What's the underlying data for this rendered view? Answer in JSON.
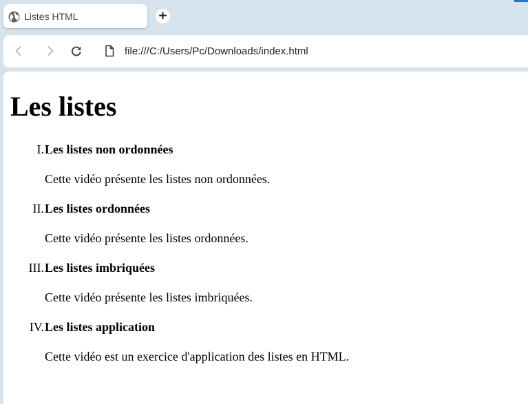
{
  "browser": {
    "tab": {
      "title": "Listes HTML",
      "icon": "globe-icon"
    },
    "new_tab_icon": "+",
    "toolbar": {
      "back_icon": "back-arrow-icon",
      "forward_icon": "forward-arrow-icon",
      "reload_icon": "reload-icon",
      "page_icon": "file-icon",
      "url": "file:///C:/Users/Pc/Downloads/index.html"
    },
    "accent_color": "#1a73e8"
  },
  "page": {
    "heading": "Les listes",
    "list_type": "upper-roman",
    "items": [
      {
        "marker": "I.",
        "title": "Les listes non ordonnées",
        "description": "Cette vidéo présente les listes non ordonnées."
      },
      {
        "marker": "II.",
        "title": "Les listes ordonnées",
        "description": "Cette vidéo présente les listes ordonnées."
      },
      {
        "marker": "III.",
        "title": "Les listes imbriquées",
        "description": "Cette vidéo présente les listes imbriquées."
      },
      {
        "marker": "IV.",
        "title": "Les listes application",
        "description": "Cette vidéo est un exercice d'application des listes en HTML."
      }
    ]
  }
}
